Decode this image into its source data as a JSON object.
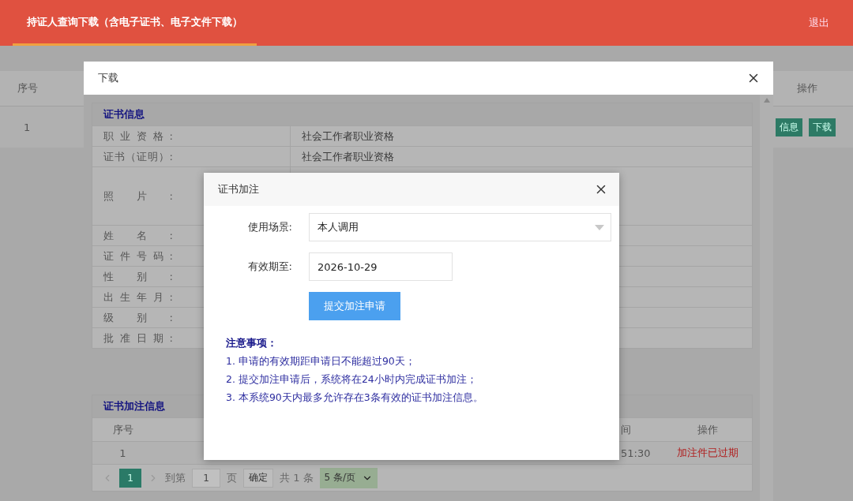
{
  "header": {
    "tabs": [
      {
        "label": "持证人查询下载（含电子证书、电子文件下载）",
        "selected": true
      }
    ],
    "logout": "退出"
  },
  "main_table": {
    "columns": [
      "序号",
      "操作"
    ],
    "rows": [
      {
        "index": "1",
        "actions": [
          "信息",
          "下载"
        ]
      }
    ]
  },
  "download_dialog": {
    "title": "下载",
    "cert_panel": {
      "title": "证书信息",
      "rows": [
        {
          "kind": "text",
          "label": "职业资格:",
          "value": "社会工作者职业资格"
        },
        {
          "kind": "text",
          "label": "证书（证明）:",
          "value": "社会工作者职业资格"
        },
        {
          "kind": "photo",
          "label": "照片:"
        },
        {
          "kind": "text",
          "label": "姓名:"
        },
        {
          "kind": "text",
          "label": "证件号码:"
        },
        {
          "kind": "text",
          "label": "性别:"
        },
        {
          "kind": "text",
          "label": "出生年月:"
        },
        {
          "kind": "text",
          "label": "级别:"
        },
        {
          "kind": "text",
          "label": "批准日期:"
        }
      ]
    },
    "annotation_panel": {
      "title": "证书加注信息",
      "columns": [
        "序号",
        "间",
        "操作"
      ],
      "rows": [
        {
          "index": "1",
          "time": "51:30",
          "status": "加注件已过期"
        }
      ],
      "pagination": {
        "pages": [
          {
            "label": "1",
            "selected": true
          }
        ],
        "goto_label": "到第",
        "goto_value": "1",
        "page_label": "页",
        "confirm": "确定",
        "total": "共 1 条",
        "page_size": "5 条/页"
      }
    }
  },
  "annotation_dialog": {
    "title": "证书加注",
    "fields": [
      {
        "kind": "select",
        "label": "使用场景:",
        "value": "本人调用"
      },
      {
        "kind": "input",
        "label": "有效期至:",
        "value": "2026-10-29"
      }
    ],
    "submit": "提交加注申请",
    "notes": {
      "title": "注意事项：",
      "items": [
        "1. 申请的有效期距申请日不能超过90天；",
        "2. 提交加注申请后，系统将在24小时内完成证书加注；",
        "3. 本系统90天内最多允许存在3条有效的证书加注信息。"
      ]
    }
  }
}
